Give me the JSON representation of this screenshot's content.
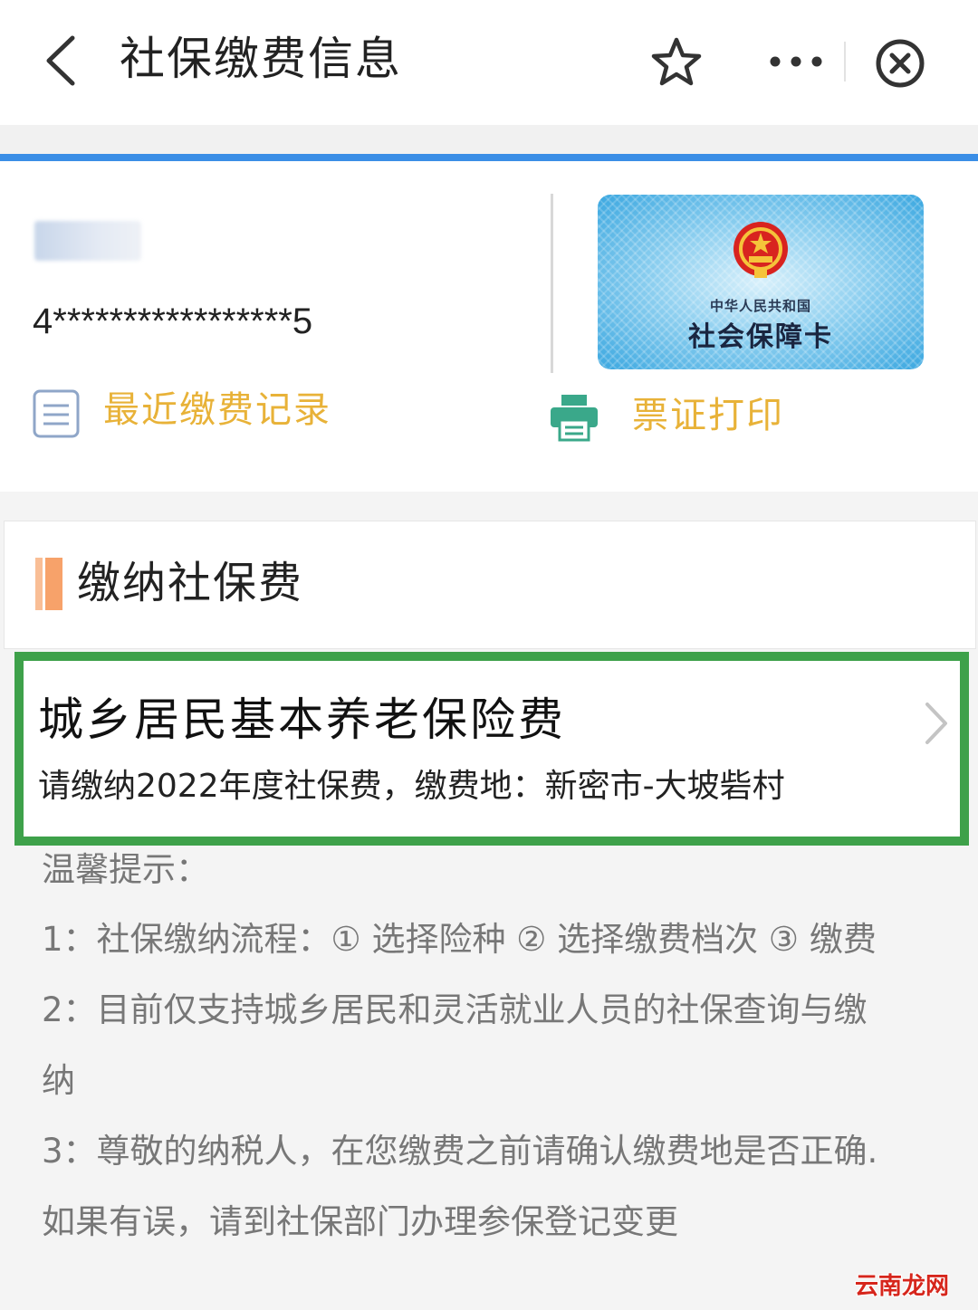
{
  "header": {
    "title": "社保缴费信息",
    "icons": [
      "back-icon",
      "star-icon",
      "more-icon",
      "close-circle-icon"
    ]
  },
  "profile": {
    "id_number": "4*****************5",
    "card": {
      "subtitle": "中华人民共和国",
      "title": "社会保障卡"
    },
    "actions": {
      "recent_records": "最近缴费记录",
      "print": "票证打印"
    }
  },
  "pay_section": {
    "title": "缴纳社保费"
  },
  "insurance_item": {
    "title": "城乡居民基本养老保险费",
    "subtitle": "请缴纳2022年度社保费，缴费地：新密市-大坡砦村"
  },
  "tips": {
    "heading": "温馨提示：",
    "lines": [
      "1：社保缴纳流程：① 选择险种 ② 选择缴费档次 ③ 缴费",
      "2：目前仅支持城乡居民和灵活就业人员的社保查询与缴",
      "纳",
      "3：尊敬的纳税人，在您缴费之前请确认缴费地是否正确.",
      "如果有误，请到社保部门办理参保登记变更"
    ]
  },
  "watermark": "云南龙网",
  "colors": {
    "accent_blue": "#3a8ee6",
    "action_gold": "#e8b238",
    "highlight_green": "#3ea14a",
    "section_orange": "#f7a26a",
    "printer_green": "#3aa88a"
  }
}
